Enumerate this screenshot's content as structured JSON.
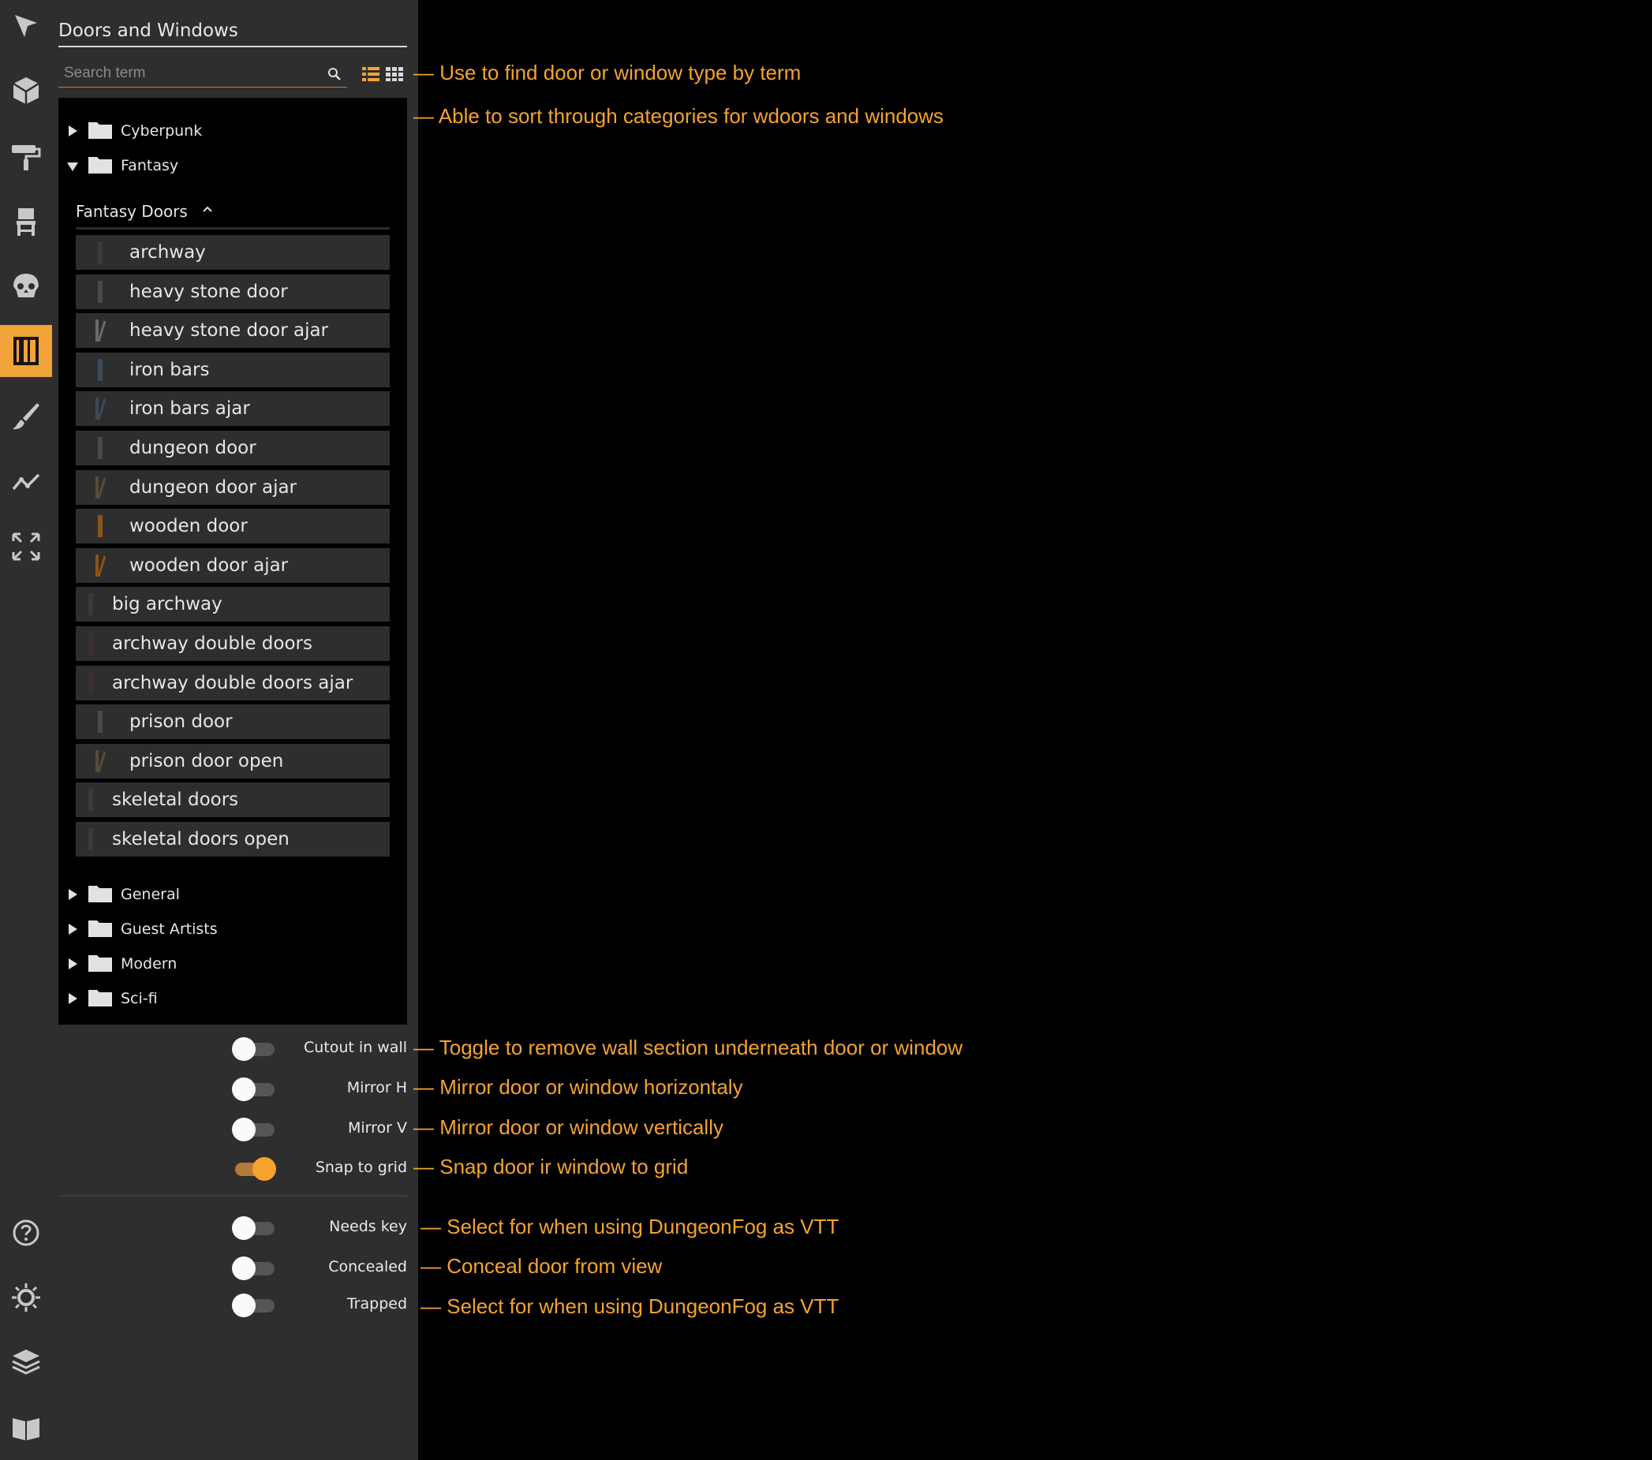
{
  "toolbar": {
    "tools": [
      {
        "name": "select-tool-icon",
        "active": false
      },
      {
        "name": "cube-tool-icon",
        "active": false
      },
      {
        "name": "paint-roller-icon",
        "active": false
      },
      {
        "name": "chair-icon",
        "active": false
      },
      {
        "name": "skull-icon",
        "active": false
      },
      {
        "name": "door-icon",
        "active": true
      },
      {
        "name": "brush-icon",
        "active": false
      },
      {
        "name": "path-icon",
        "active": false
      },
      {
        "name": "expand-icon",
        "active": false
      },
      {
        "name": "help-icon",
        "active": false
      },
      {
        "name": "light-icon",
        "active": false
      },
      {
        "name": "layers-icon",
        "active": false
      },
      {
        "name": "book-icon",
        "active": false
      }
    ],
    "accent_color": "#f2a33a"
  },
  "panel": {
    "title": "Doors and Windows",
    "search_placeholder": "Search term",
    "search_value": "",
    "view_modes": [
      "list",
      "grid"
    ],
    "active_view": "list"
  },
  "tree": {
    "folders_top": [
      {
        "label": "Cyberpunk",
        "expanded": false
      },
      {
        "label": "Fantasy",
        "expanded": true
      }
    ],
    "subcategory": "Fantasy Doors",
    "items": [
      "archway",
      "heavy stone door",
      "heavy stone door ajar",
      "iron bars",
      "iron bars ajar",
      "dungeon door",
      "dungeon door ajar",
      "wooden door",
      "wooden door ajar",
      "big archway",
      "archway double doors",
      "archway double doors ajar",
      "prison door",
      "prison door open",
      "skeletal doors",
      "skeletal doors open"
    ],
    "folders_bottom": [
      {
        "label": "General",
        "expanded": false
      },
      {
        "label": "Guest Artists",
        "expanded": false
      },
      {
        "label": "Modern",
        "expanded": false
      },
      {
        "label": "Sci-fi",
        "expanded": false
      }
    ]
  },
  "toggles": [
    {
      "label": "Cutout in wall",
      "on": false
    },
    {
      "label": "Mirror H",
      "on": false
    },
    {
      "label": "Mirror V",
      "on": false
    },
    {
      "label": "Snap to grid",
      "on": true
    },
    {
      "label": "Needs key",
      "on": false
    },
    {
      "label": "Concealed",
      "on": false
    },
    {
      "label": "Trapped",
      "on": false
    }
  ],
  "annotations": {
    "search": "— Use to find door or window type by term",
    "categories": "— Able to sort through categories for wdoors and windows",
    "cutout": "— Toggle to remove wall section underneath door or window",
    "mirror_h": "— Mirror door or window horizontaly",
    "mirror_v": "— Mirror door or window vertically",
    "snap": "— Snap door ir window to grid",
    "needs_key": "— Select for when using DungeonFog as VTT",
    "concealed": "— Conceal door from view",
    "trapped": "— Select for when using DungeonFog as VTT",
    "color": "#f5a32e"
  }
}
